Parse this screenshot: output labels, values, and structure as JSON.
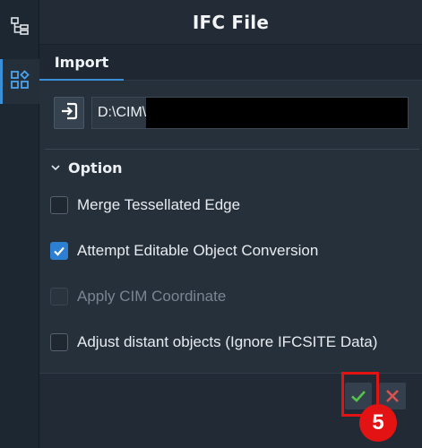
{
  "window": {
    "title": "IFC File"
  },
  "sidebar": {
    "items": [
      {
        "icon": "tree-structure-icon",
        "active": false
      },
      {
        "icon": "grid-add-icon",
        "active": true
      }
    ]
  },
  "tabs": [
    {
      "label": "Import",
      "active": true
    }
  ],
  "file": {
    "path": "D:\\CIM\\"
  },
  "option_section": {
    "label": "Option",
    "expanded": true
  },
  "options": [
    {
      "label": "Merge Tessellated Edge",
      "checked": false,
      "disabled": false
    },
    {
      "label": "Attempt Editable Object Conversion",
      "checked": true,
      "disabled": false
    },
    {
      "label": "Apply CIM Coordinate",
      "checked": false,
      "disabled": true
    },
    {
      "label": "Adjust distant objects (Ignore IFCSITE Data)",
      "checked": false,
      "disabled": false
    }
  ],
  "footer": {
    "confirm_icon": "check-icon",
    "cancel_icon": "close-icon"
  },
  "annotation": {
    "step": "5",
    "color": "#e31313"
  },
  "colors": {
    "accent": "#3b8fd6",
    "confirm": "#57c24a",
    "cancel": "#d9534f"
  }
}
